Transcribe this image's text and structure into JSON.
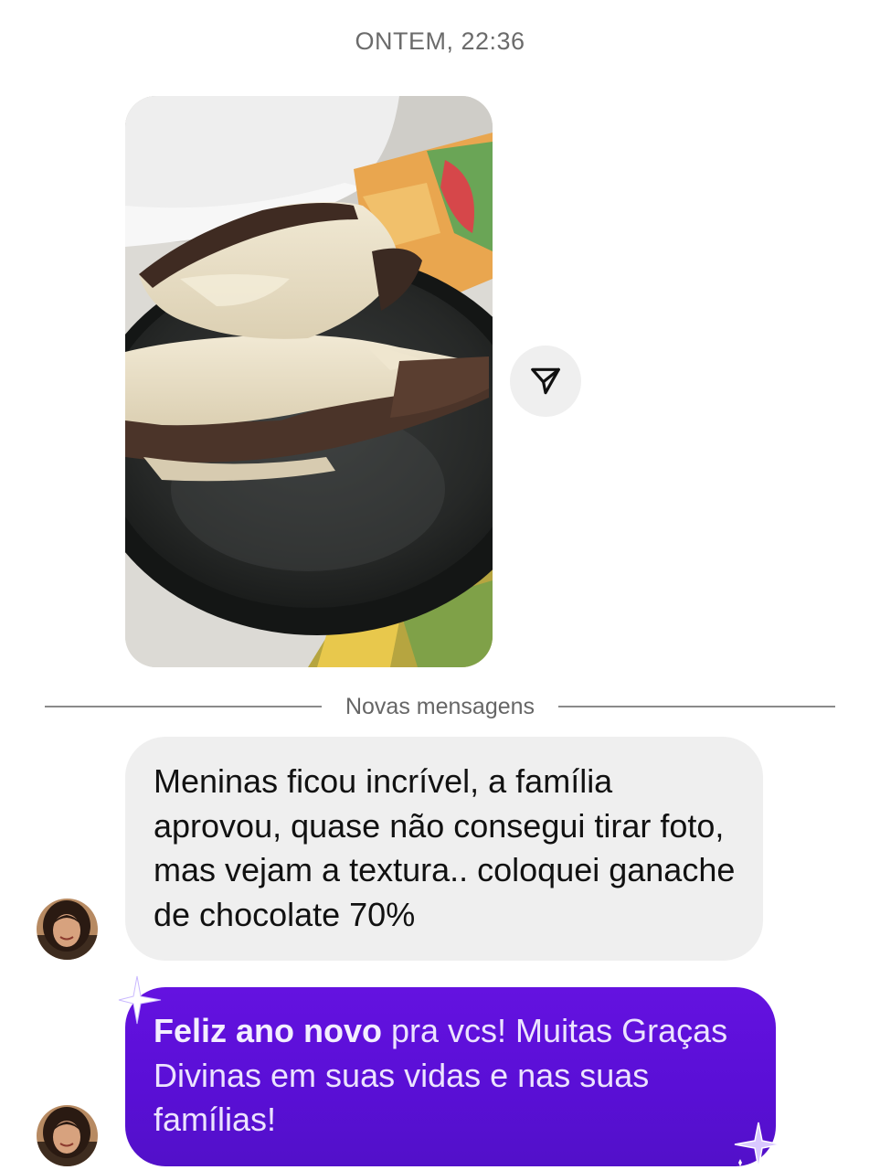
{
  "timestamp": "ONTEM, 22:36",
  "divider": {
    "label": "Novas mensagens"
  },
  "messages": [
    {
      "type": "text",
      "text": "Meninas ficou incrível, a família aprovou, quase não consegui tirar foto, mas vejam a textura.. coloquei ganache de chocolate 70%"
    },
    {
      "type": "effect",
      "bold": "Feliz ano novo",
      "text": " pra vcs! Muitas Graças Divinas em suas  vidas e nas suas famílias!"
    }
  ],
  "icons": {
    "share": "send-paper-plane-icon",
    "sparkle": "sparkle-icon"
  },
  "colors": {
    "received_bubble": "#efefef",
    "effect_bubble": "#5a0fd6",
    "divider": "#8a8a8a",
    "timestamp": "#6b6b6b"
  }
}
